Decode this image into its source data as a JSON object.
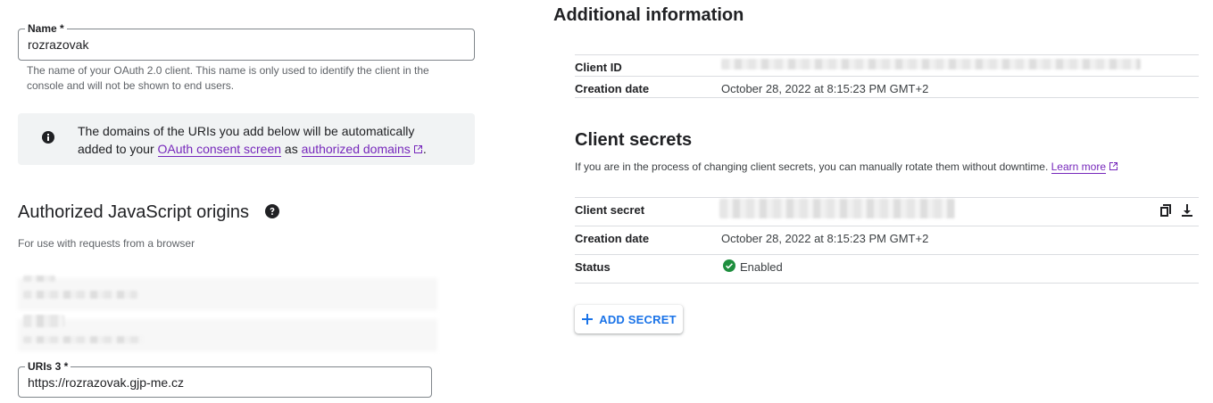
{
  "colors": {
    "accent": "#1a73e8",
    "link": "#7627bb",
    "success": "#1e8e3e",
    "banner_bg": "#f1f3f4"
  },
  "name_field": {
    "label": "Name *",
    "value": "rozrazovak",
    "hint": "The name of your OAuth 2.0 client. This name is only used to identify the client in the console and will not be shown to end users."
  },
  "banner": {
    "icon": "info-icon",
    "text_before": "The domains of the URIs you add below will be automatically added to your ",
    "link1": "OAuth consent screen",
    "text_middle": " as ",
    "link2": "authorized domains",
    "text_after": "."
  },
  "js_origins": {
    "title": "Authorized JavaScript origins",
    "help_icon": "help-icon",
    "subtitle": "For use with requests from a browser",
    "uri3_label": "URIs 3 *",
    "uri3_value": "https://rozrazovak.gjp-me.cz"
  },
  "additional_info": {
    "title": "Additional information",
    "client_id_label": "Client ID",
    "creation_date_label": "Creation date",
    "creation_date_value": "October 28, 2022 at 8:15:23 PM GMT+2"
  },
  "client_secrets": {
    "title": "Client secrets",
    "description": "If you are in the process of changing client secrets, you can manually rotate them without downtime. ",
    "learn_more": "Learn more",
    "secret_label": "Client secret",
    "creation_date_label": "Creation date",
    "creation_date_value": "October 28, 2022 at 8:15:23 PM GMT+2",
    "status_label": "Status",
    "status_value": "Enabled",
    "copy_icon": "copy-icon",
    "download_icon": "download-icon",
    "add_secret_label": "ADD SECRET"
  }
}
